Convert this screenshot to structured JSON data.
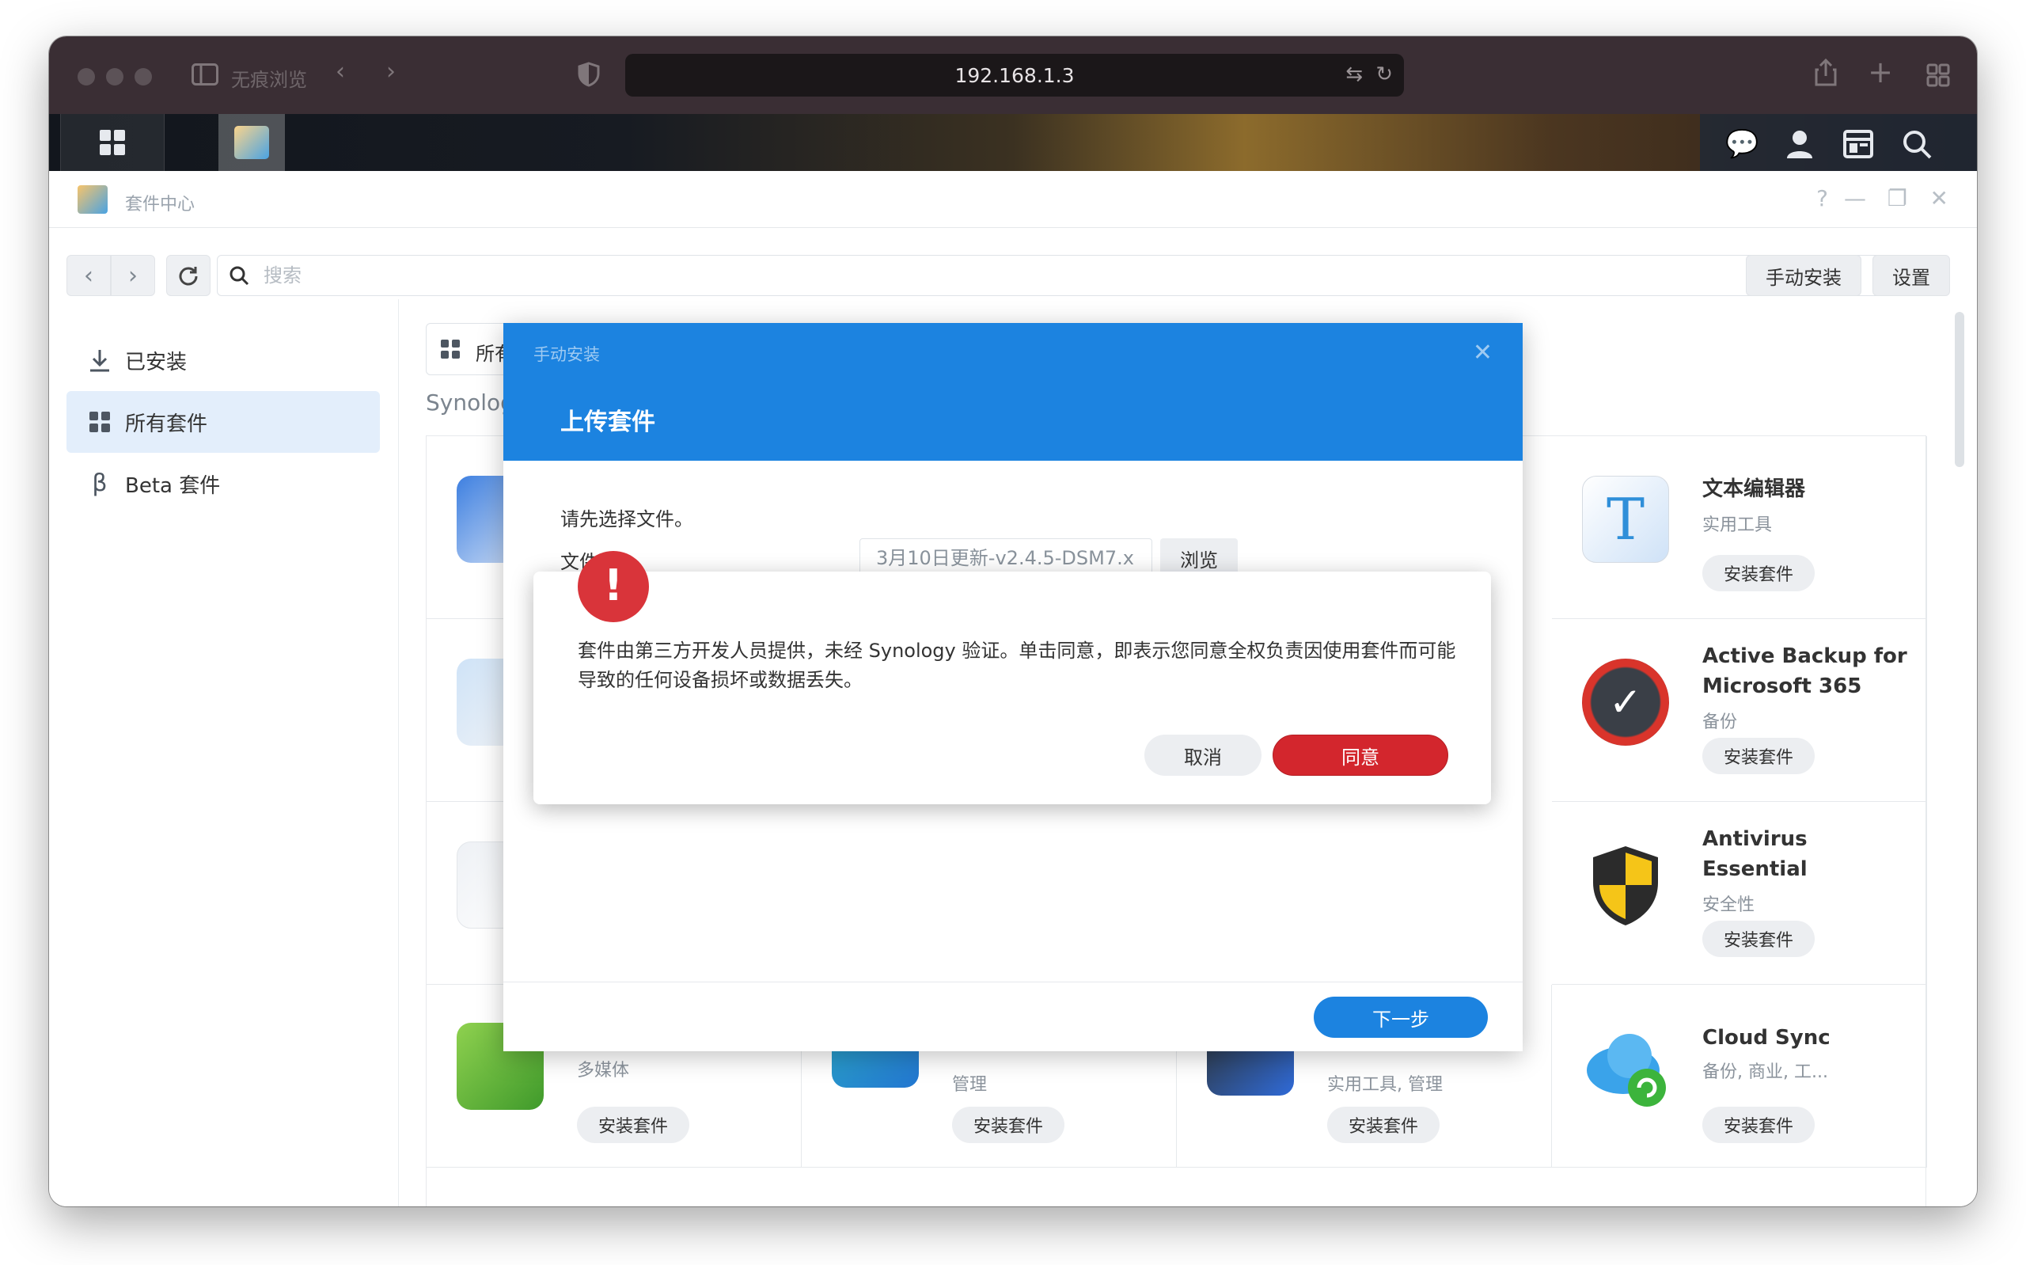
{
  "browser": {
    "private_label": "无痕浏览",
    "address": "192.168.1.3"
  },
  "app": {
    "title": "套件中心",
    "search": {
      "placeholder": "搜索",
      "value": ""
    },
    "toolbar": {
      "manual_install": "手动安装",
      "settings": "设置"
    },
    "sidebar": {
      "items": [
        {
          "label": "已安装",
          "icon": "download-icon",
          "active": false
        },
        {
          "label": "所有套件",
          "icon": "grid-icon",
          "active": true
        },
        {
          "label": "Beta 套件",
          "icon": "beta-icon",
          "active": false
        }
      ]
    },
    "filter_label": "所有",
    "section_title": "Synolog",
    "packages": [
      {
        "name": "文本编辑器",
        "category": "实用工具",
        "button": "安装套件",
        "icon": "text-editor-icon"
      },
      {
        "name": "Active Backup for Microsoft 365",
        "category": "备份",
        "button": "安装套件",
        "icon": "active-backup-icon"
      },
      {
        "name": "Antivirus Essential",
        "category": "安全性",
        "button": "安装套件",
        "icon": "antivirus-icon"
      },
      {
        "name": "Cloud Sync",
        "category": "备份, 商业, 工...",
        "button": "安装套件",
        "icon": "cloud-sync-icon"
      }
    ],
    "bottom_row": [
      {
        "category": "多媒体",
        "button": "安装套件"
      },
      {
        "category": "管理",
        "button": "安装套件"
      },
      {
        "category": "实用工具, 管理",
        "button": "安装套件"
      }
    ]
  },
  "dialog": {
    "subtitle": "手动安装",
    "title": "上传套件",
    "prompt": "请先选择文件。",
    "file_label": "文件",
    "file_value": "3月10日更新-v2.4.5-DSM7.x",
    "browse": "浏览",
    "next": "下一步"
  },
  "alert": {
    "message": "套件由第三方开发人员提供，未经 Synology 验证。单击同意，即表示您同意全权负责因使用套件而可能导致的任何设备损坏或数据丢失。",
    "cancel": "取消",
    "agree": "同意"
  },
  "colors": {
    "accent": "#1c83e0",
    "danger": "#d3262d",
    "titlebar": "#3a2e34"
  }
}
